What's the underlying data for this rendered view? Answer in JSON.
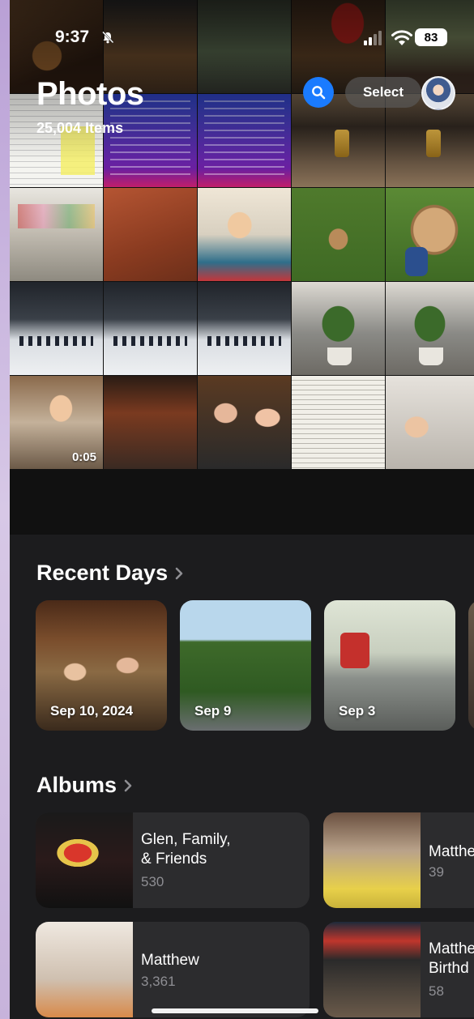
{
  "status_bar": {
    "time": "9:37",
    "battery": "83"
  },
  "header": {
    "title": "Photos",
    "count": "25,004 Items",
    "select_label": "Select"
  },
  "grid": {
    "video_duration": "0:05"
  },
  "recent_days": {
    "title": "Recent Days",
    "cards": [
      {
        "label": "Sep 10, 2024"
      },
      {
        "label": "Sep 9"
      },
      {
        "label": "Sep 3"
      }
    ]
  },
  "albums": {
    "title": "Albums",
    "items": [
      {
        "name": "Glen, Family,\n& Friends",
        "count": "530"
      },
      {
        "name": "Matthe",
        "count": "39"
      },
      {
        "name": "Matthew",
        "count": "3,361"
      },
      {
        "name": "Matthe\nBirthd",
        "count": "58"
      }
    ]
  },
  "colors": {
    "accent": "#1a7bff",
    "background": "#1c1c1e",
    "card": "#2c2c2e",
    "secondary_text": "#8e8e93"
  },
  "icons": [
    "bell-off-icon",
    "signal-icon",
    "wifi-icon",
    "search-icon",
    "chevron-right-icon"
  ]
}
